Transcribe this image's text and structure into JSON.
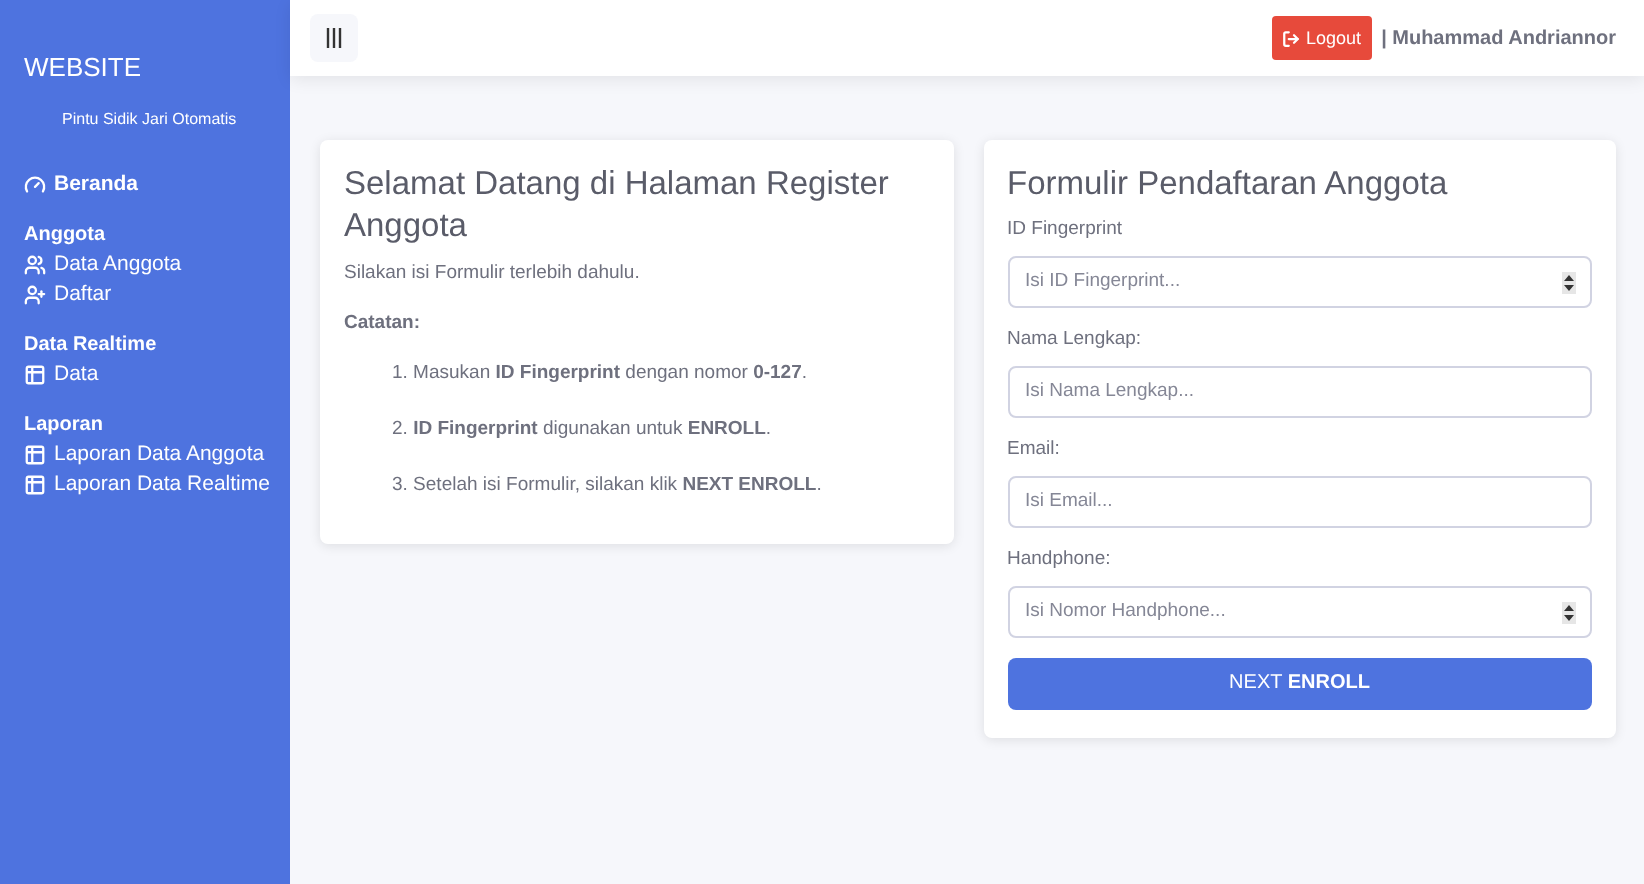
{
  "sidebar": {
    "brand": "WEBSITE",
    "subtitle": "Pintu Sidik Jari Otomatis",
    "sections": [
      {
        "items": [
          {
            "label": "Beranda",
            "kind": "dashboard",
            "bold": true
          }
        ]
      },
      {
        "heading": "Anggota",
        "items": [
          {
            "label": "Data Anggota",
            "kind": "members",
            "bold": false
          },
          {
            "label": "Daftar",
            "kind": "register",
            "bold": false
          }
        ]
      },
      {
        "heading": "Data Realtime",
        "items": [
          {
            "label": "Data",
            "kind": "table",
            "bold": false
          }
        ]
      },
      {
        "heading": "Laporan",
        "items": [
          {
            "label": "Laporan Data Anggota",
            "kind": "table",
            "bold": false
          },
          {
            "label": "Laporan Data Realtime",
            "kind": "table",
            "bold": false
          }
        ]
      }
    ]
  },
  "topbar": {
    "logout": "Logout",
    "user": "| Muhammad Andriannor"
  },
  "welcome": {
    "title": "Selamat Datang di Halaman Register Anggota",
    "intro": "Silakan isi Formulir terlebih dahulu.",
    "notes_heading": "Catatan:",
    "notes": [
      "1. Masukan **ID Fingerprint** dengan nomor **0-127**.",
      "2. **ID Fingerprint** digunakan untuk **ENROLL**.",
      "3. Setelah isi Formulir, silakan klik **NEXT ENROLL**."
    ]
  },
  "form": {
    "title": "Formulir Pendaftaran Anggota",
    "fields": [
      {
        "label": "ID Fingerprint",
        "placeholder": "Isi ID Fingerprint...",
        "kind": "number"
      },
      {
        "label": "Nama Lengkap:",
        "placeholder": "Isi Nama Lengkap...",
        "kind": "text"
      },
      {
        "label": "Email:",
        "placeholder": "Isi Email...",
        "kind": "text"
      },
      {
        "label": "Handphone:",
        "placeholder": "Isi Nomor Handphone...",
        "kind": "number"
      }
    ],
    "submit": "NEXT **ENROLL**"
  }
}
